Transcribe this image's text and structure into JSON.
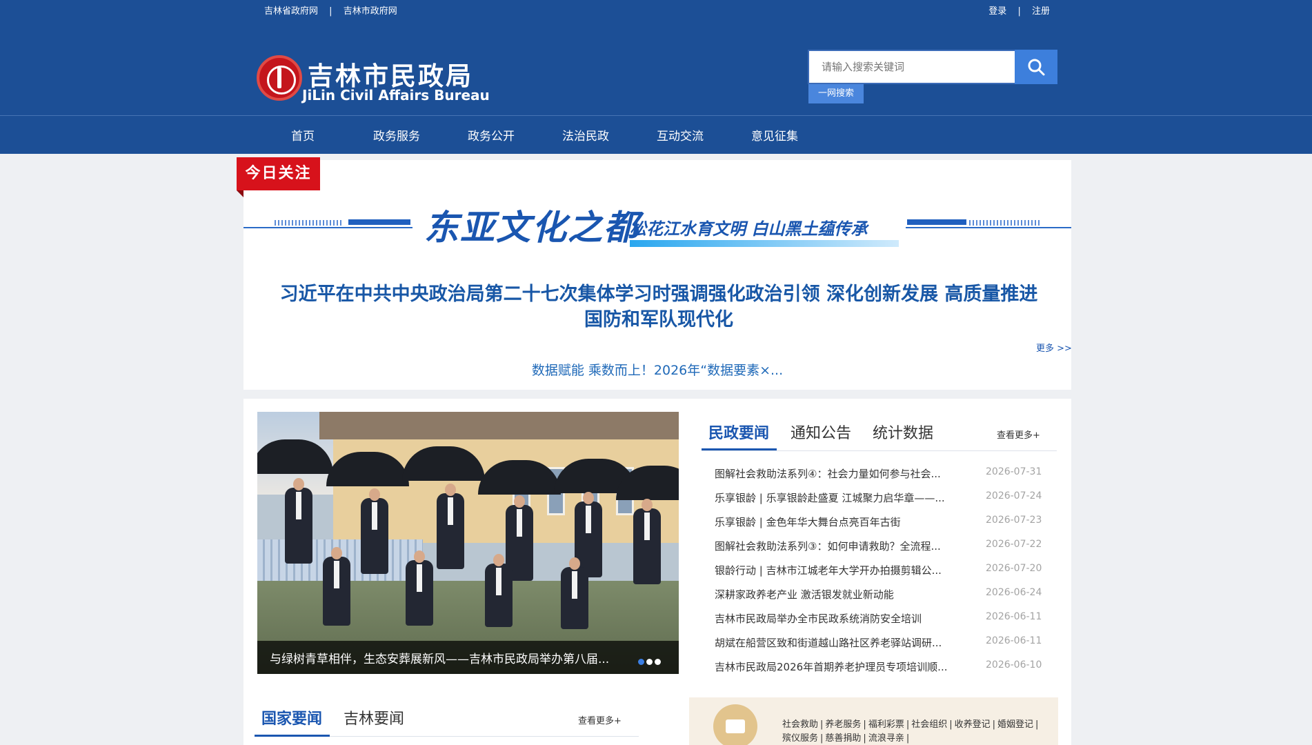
{
  "topbar": {
    "left_links": [
      "吉林省政府网",
      "吉林市政府网"
    ],
    "separator": "|",
    "right_links": [
      "登录",
      "注册"
    ]
  },
  "logo": {
    "title_cn": "吉林市民政局",
    "title_en": "JiLin Civil Affairs Bureau"
  },
  "search": {
    "placeholder": "请输入搜索关键词",
    "tag": "一网搜索"
  },
  "nav": [
    "首页",
    "政务服务",
    "政务公开",
    "法治民政",
    "互动交流",
    "意见征集"
  ],
  "focus": {
    "tag": "今日关注",
    "banner_main": "东亚文化之都",
    "banner_sub": "松花江水育文明 白山黑土蕴传承",
    "headline": "习近平在中共中央政治局第二十七次集体学习时强调强化政治引领 深化创新发展 高质量推进国防和军队现代化",
    "more": "更多 >>",
    "subnews": "数据赋能 乘数而上！2026年“数据要素×..."
  },
  "carousel": {
    "caption": "与绿树青草相伴，生态安葬展新风——吉林市民政局举办第八届...",
    "dots": 3,
    "active_dot": 0
  },
  "news_tabs": {
    "tabs": [
      "民政要闻",
      "通知公告",
      "统计数据"
    ],
    "active": 0,
    "more": "查看更多+"
  },
  "news": [
    {
      "title": "图解社会救助法系列④：社会力量如何参与社会...",
      "date": "2026-07-31"
    },
    {
      "title": "乐享银龄 | 乐享银龄赴盛夏 江城聚力启华章——...",
      "date": "2026-07-24"
    },
    {
      "title": "乐享银龄 | 金色年华大舞台点亮百年古街",
      "date": "2026-07-23"
    },
    {
      "title": "图解社会救助法系列③：如何申请救助？全流程...",
      "date": "2026-07-22"
    },
    {
      "title": "银龄行动 | 吉林市江城老年大学开办拍摄剪辑公...",
      "date": "2026-07-20"
    },
    {
      "title": "深耕家政养老产业 激活银发就业新动能",
      "date": "2026-06-24"
    },
    {
      "title": "吉林市民政局举办全市民政系统消防安全培训",
      "date": "2026-06-11"
    },
    {
      "title": "胡斌在船营区致和街道越山路社区养老驿站调研...",
      "date": "2026-06-11"
    },
    {
      "title": "吉林市民政局2026年首期养老护理员专项培训顺...",
      "date": "2026-06-10"
    }
  ],
  "bottom_tabs": {
    "tabs": [
      "国家要闻",
      "吉林要闻"
    ],
    "active": 0,
    "more": "查看更多+"
  },
  "services": [
    "社会救助",
    "养老服务",
    "福利彩票",
    "社会组织",
    "收养登记",
    "婚姻登记",
    "殡仪服务",
    "慈善捐助",
    "流浪寻亲"
  ],
  "colors": {
    "header_blue": "#1c4f96",
    "accent_red": "#d7121b",
    "link_blue": "#1a56b0"
  }
}
